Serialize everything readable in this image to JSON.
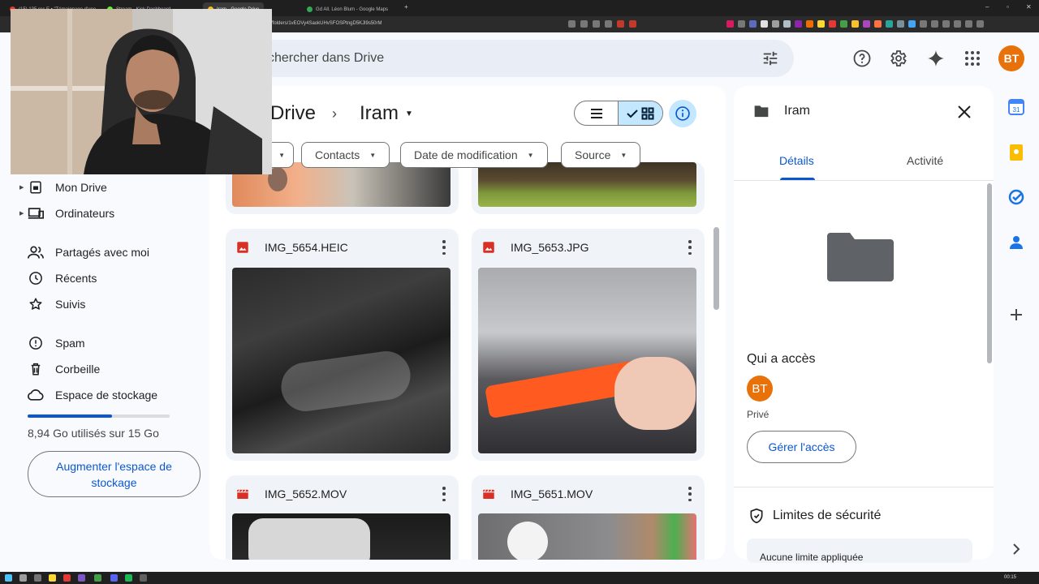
{
  "browser": {
    "tabs": [
      {
        "label": "(15) 135 rec E • \"Témoignage d'une ...",
        "color": "#e53935"
      },
      {
        "label": "Stream - Kick Dashboard",
        "color": "#53fc18"
      },
      {
        "label": "Iram - Google Drive",
        "color": "#fbbc04"
      },
      {
        "label": "Gd All. Léon Blum - Google Maps",
        "color": "#34a853"
      }
    ],
    "url": "/folders/1vEOVy4SaokUHvSFOSPtngD5KJl9s50rM"
  },
  "header": {
    "search_placeholder": "chercher dans Drive",
    "avatar_initials": "BT"
  },
  "sidebar": {
    "items": [
      {
        "label": "Mon Drive",
        "icon": "drive-icon"
      },
      {
        "label": "Ordinateurs",
        "icon": "computers-icon"
      },
      {
        "label": "Partagés avec moi",
        "icon": "shared-icon"
      },
      {
        "label": "Récents",
        "icon": "clock-icon"
      },
      {
        "label": "Suivis",
        "icon": "star-icon"
      },
      {
        "label": "Spam",
        "icon": "spam-icon"
      },
      {
        "label": "Corbeille",
        "icon": "trash-icon"
      },
      {
        "label": "Espace de stockage",
        "icon": "cloud-icon"
      }
    ],
    "storage_text": "8,94 Go utilisés sur 15 Go",
    "storage_fraction": 0.596,
    "upgrade_label": "Augmenter l'espace de stockage"
  },
  "main": {
    "breadcrumb_root": "Drive",
    "breadcrumb_folder": "Iram",
    "filters": [
      "Contacts",
      "Date de modification",
      "Source"
    ],
    "files": [
      {
        "name": "IMG_5654.HEIC",
        "type": "image"
      },
      {
        "name": "IMG_5653.JPG",
        "type": "image"
      },
      {
        "name": "IMG_5652.MOV",
        "type": "video"
      },
      {
        "name": "IMG_5651.MOV",
        "type": "video"
      }
    ]
  },
  "details": {
    "folder_name": "Iram",
    "tab_details": "Détails",
    "tab_activity": "Activité",
    "access_title": "Qui a accès",
    "owner_initials": "BT",
    "privacy": "Privé",
    "manage_label": "Gérer l'accès",
    "security_title": "Limites de sécurité",
    "security_text": "Aucune limite appliquée"
  },
  "taskbar": {
    "clock": "00:15"
  },
  "colors": {
    "accent": "#0b57d0",
    "selected": "#c2e7ff",
    "avatar": "#e8710a",
    "image_icon": "#d93025"
  }
}
